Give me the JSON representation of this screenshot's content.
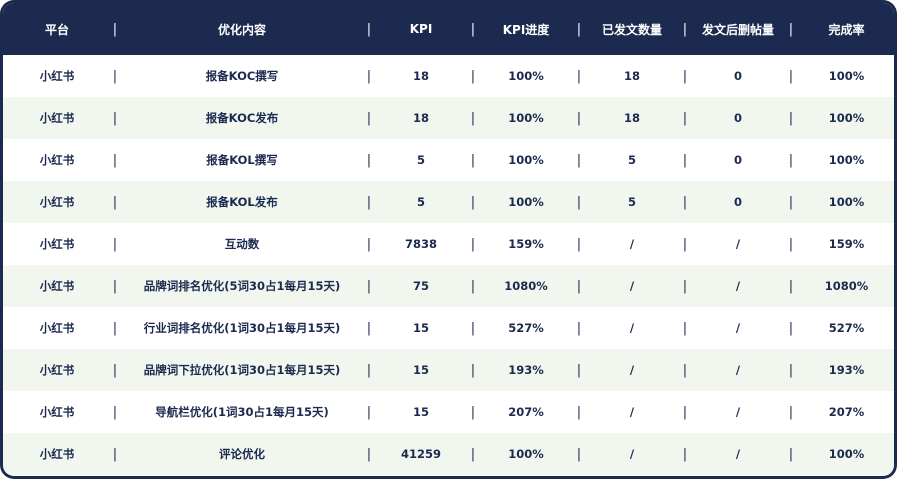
{
  "header": {
    "platform": "平台",
    "content": "优化内容",
    "kpi": "KPI",
    "kpi_progress": "KPI进度",
    "sent_count": "已发文数量",
    "deleted_count": "发文后删帖量",
    "completion_rate": "完成率",
    "separator": "|"
  },
  "rows": [
    {
      "platform": "小红书",
      "content": "报备KOC撰写",
      "kpi": "18",
      "kpi_progress": "100%",
      "sent_count": "18",
      "deleted_count": "0",
      "completion_rate": "100%"
    },
    {
      "platform": "小红书",
      "content": "报备KOC发布",
      "kpi": "18",
      "kpi_progress": "100%",
      "sent_count": "18",
      "deleted_count": "0",
      "completion_rate": "100%"
    },
    {
      "platform": "小红书",
      "content": "报备KOL撰写",
      "kpi": "5",
      "kpi_progress": "100%",
      "sent_count": "5",
      "deleted_count": "0",
      "completion_rate": "100%"
    },
    {
      "platform": "小红书",
      "content": "报备KOL发布",
      "kpi": "5",
      "kpi_progress": "100%",
      "sent_count": "5",
      "deleted_count": "0",
      "completion_rate": "100%"
    },
    {
      "platform": "小红书",
      "content": "互动数",
      "kpi": "7838",
      "kpi_progress": "159%",
      "sent_count": "/",
      "deleted_count": "/",
      "completion_rate": "159%"
    },
    {
      "platform": "小红书",
      "content": "品牌词排名优化(5词30占1每月15天)",
      "kpi": "75",
      "kpi_progress": "1080%",
      "sent_count": "/",
      "deleted_count": "/",
      "completion_rate": "1080%"
    },
    {
      "platform": "小红书",
      "content": "行业词排名优化(1词30占1每月15天)",
      "kpi": "15",
      "kpi_progress": "527%",
      "sent_count": "/",
      "deleted_count": "/",
      "completion_rate": "527%"
    },
    {
      "platform": "小红书",
      "content": "品牌词下拉优化(1词30占1每月15天)",
      "kpi": "15",
      "kpi_progress": "193%",
      "sent_count": "/",
      "deleted_count": "/",
      "completion_rate": "193%"
    },
    {
      "platform": "小红书",
      "content": "导航栏优化(1词30占1每月15天)",
      "kpi": "15",
      "kpi_progress": "207%",
      "sent_count": "/",
      "deleted_count": "/",
      "completion_rate": "207%"
    },
    {
      "platform": "小红书",
      "content": "评论优化",
      "kpi": "41259",
      "kpi_progress": "100%",
      "sent_count": "/",
      "deleted_count": "/",
      "completion_rate": "100%"
    }
  ],
  "colors": {
    "header_bg": "#1b2a4e",
    "row_alt_bg": "#f1f7ef",
    "text": "#1b2a4e"
  }
}
